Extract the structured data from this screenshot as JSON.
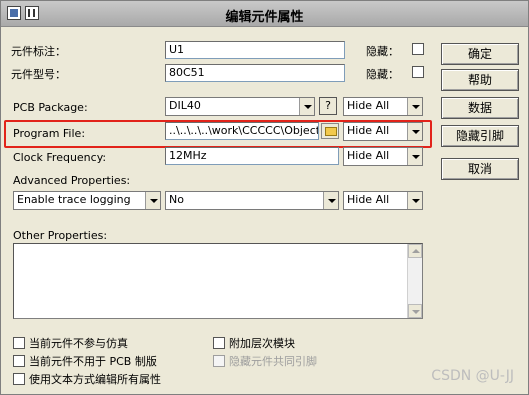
{
  "window": {
    "title": "编辑元件属性"
  },
  "fields": {
    "ref_label": "元件标注：",
    "ref_value": "U1",
    "type_label": "元件型号：",
    "type_value": "80C51",
    "hidden_label_1": "隐藏：",
    "hidden_label_2": "隐藏："
  },
  "rows": {
    "pcb_label": "PCB Package:",
    "pcb_value": "DIL40",
    "pcb_help": "?",
    "pcb_hide": "Hide All",
    "prog_label": "Program File:",
    "prog_value": "..\\..\\..\\..\\work\\CCCCC\\Objects",
    "prog_hide": "Hide All",
    "clock_label": "Clock Frequency:",
    "clock_value": "12MHz",
    "clock_hide": "Hide All",
    "adv_label": "Advanced Properties:",
    "adv_select": "Enable trace logging",
    "adv_value": "No",
    "adv_hide": "Hide All"
  },
  "other": {
    "label": "Other Properties:",
    "value": ""
  },
  "checkboxes": {
    "exclude_sim": "当前元件不参与仿真",
    "exclude_pcb": "当前元件不用于 PCB 制版",
    "edit_text": "使用文本方式编辑所有属性",
    "attach_hier": "附加层次模块",
    "hide_pins": "隐藏元件共同引脚"
  },
  "buttons": {
    "ok": "确定",
    "help": "帮助",
    "data": "数据",
    "hidden_pins": "隐藏引脚",
    "cancel": "取消"
  },
  "watermark": "CSDN @U-JJ"
}
